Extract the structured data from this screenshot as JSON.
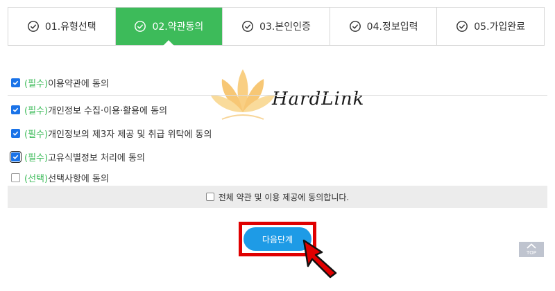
{
  "steps": [
    {
      "label": "01.유형선택",
      "active": false
    },
    {
      "label": "02.약관동의",
      "active": true
    },
    {
      "label": "03.본인인증",
      "active": false
    },
    {
      "label": "04.정보입력",
      "active": false
    },
    {
      "label": "05.가입완료",
      "active": false
    }
  ],
  "agreements": [
    {
      "tag": "(필수)",
      "text": "이용약관에 동의",
      "checked": true
    },
    {
      "tag": "(필수)",
      "text": "개인정보 수집·이용·활용에 동의",
      "checked": true
    },
    {
      "tag": "(필수)",
      "text": "개인정보의 제3자 제공 및 취급 위탁에 동의",
      "checked": true
    },
    {
      "tag": "(필수)",
      "text": "고유식별정보 처리에 동의",
      "checked": true
    },
    {
      "tag": "(선택)",
      "text": "선택사항에 동의",
      "checked": false
    }
  ],
  "agree_all_label": "전체 약관 및 이용 제공에 동의합니다.",
  "next_button": "다음단계",
  "watermark": "HardLink",
  "top_button": "TOP",
  "colors": {
    "accent_green": "#3dbb5a",
    "button_blue": "#1e9be6",
    "highlight_red": "#e00000",
    "checkbox_blue": "#1a73e8"
  }
}
